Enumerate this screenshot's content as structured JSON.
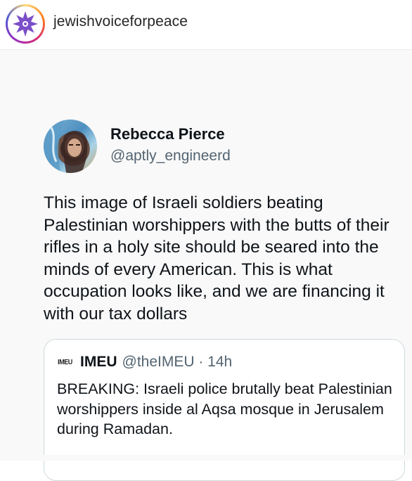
{
  "instagram": {
    "username": "jewishvoiceforpeace",
    "avatar_icon": "flower-logo-icon"
  },
  "tweet": {
    "display_name": "Rebecca Pierce",
    "handle": "@aptly_engineerd",
    "avatar_icon": "profile-photo",
    "text": "This image of Israeli soldiers beating Palestinian worshippers with the butts of their rifles in a holy site should be seared into the minds of every American. This is what occupation looks like, and we are financing it with our tax dollars"
  },
  "quote": {
    "logo_text": "IMEU",
    "name": "IMEU",
    "meta": "@theIMEU · 14h",
    "text": "BREAKING: Israeli police brutally beat Palestinian worshippers inside al Aqsa mosque in Jerusalem during Ramadan."
  },
  "colors": {
    "text_primary": "#0f1419",
    "text_secondary": "#536471",
    "card_border": "#cfd9de",
    "logo_purple": "#7b4fc9"
  }
}
